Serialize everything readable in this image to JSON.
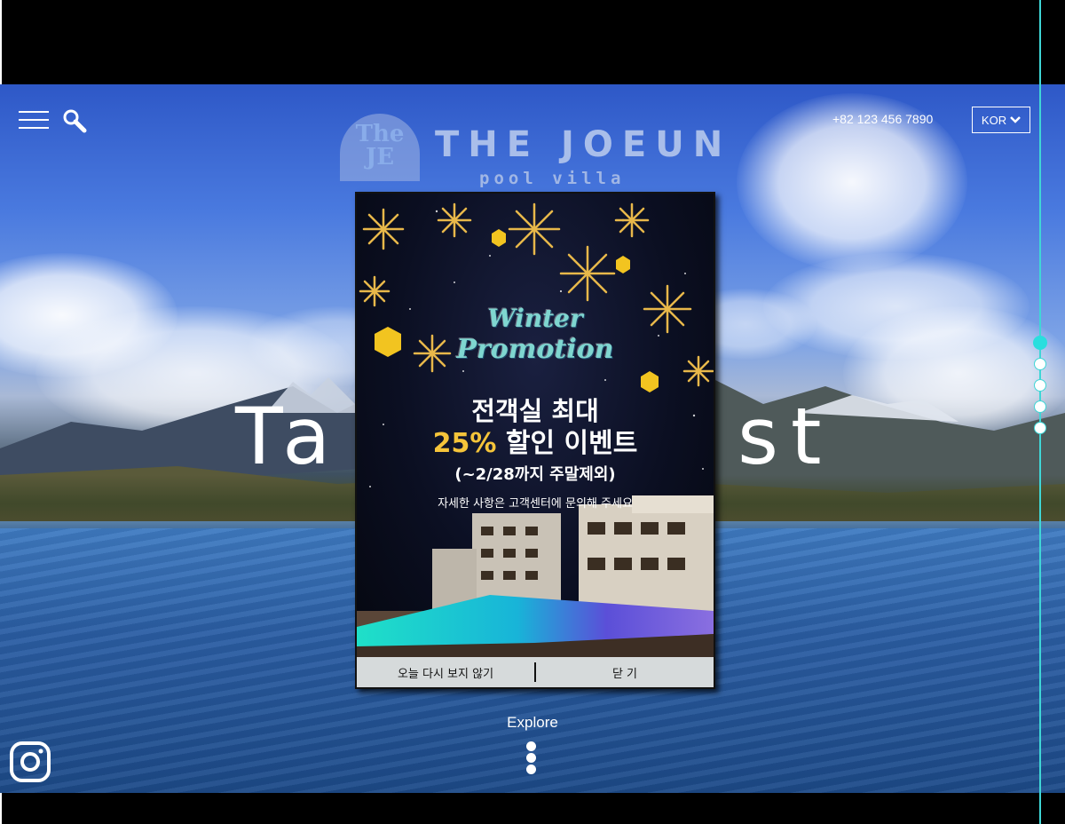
{
  "header": {
    "menu_icon": "hamburger-menu-icon",
    "search_icon": "search-icon",
    "logo": {
      "badge_text": "The JE",
      "name": "THE JOEUN",
      "subtitle": "pool villa"
    },
    "phone": "+82 123 456 7890",
    "language": "KOR"
  },
  "hero": {
    "headline_left": "Ta",
    "headline_right": "st"
  },
  "page_indicator": {
    "count": 5,
    "active_index": 0
  },
  "explore": {
    "label": "Explore"
  },
  "social": {
    "instagram_icon": "instagram-icon"
  },
  "popup": {
    "title_line1": "Winter",
    "title_line2": "Promotion",
    "line1": "전객실 최대",
    "line2_percent": "25%",
    "line2_rest": " 할인 이벤트",
    "line3": "(~2/28까지 주말제외)",
    "line4": "자세한 사항은 고객센터에 문의해 주세요",
    "dont_show_today": "오늘 다시 보지 않기",
    "close": "닫 기"
  },
  "colors": {
    "accent": "#29dede",
    "promo_gold": "#f5c43a",
    "footer_bg": "#d6dadb"
  }
}
